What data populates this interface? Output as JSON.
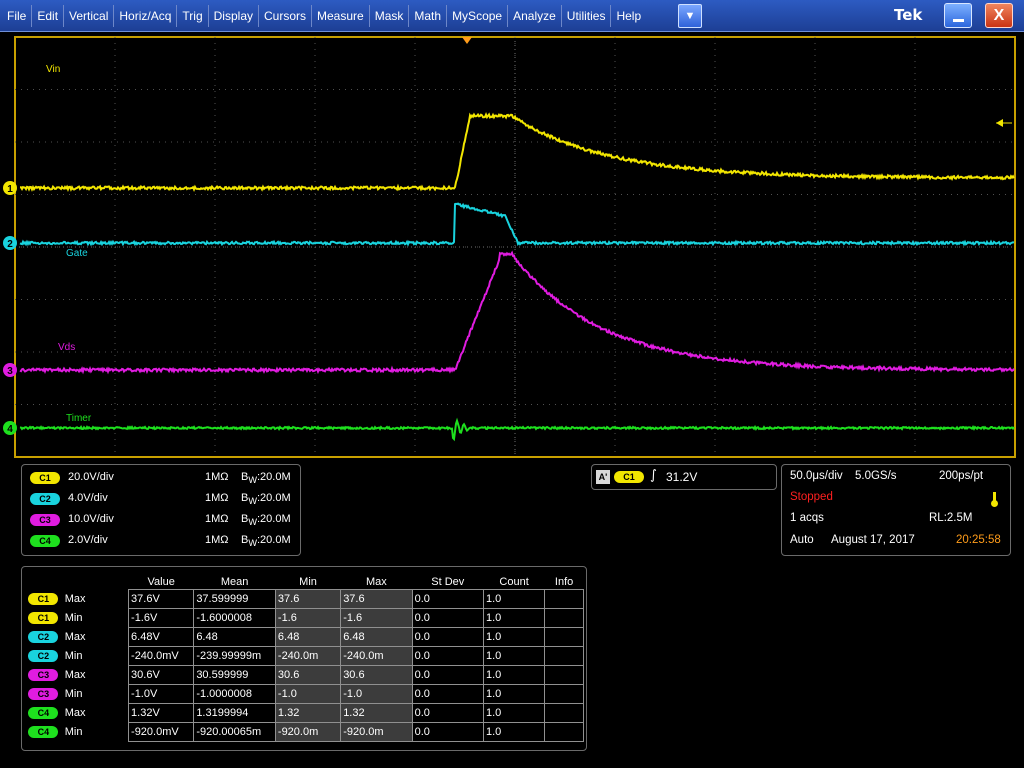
{
  "menubar": {
    "items": [
      "File",
      "Edit",
      "Vertical",
      "Horiz/Acq",
      "Trig",
      "Display",
      "Cursors",
      "Measure",
      "Mask",
      "Math",
      "MyScope",
      "Analyze",
      "Utilities",
      "Help"
    ],
    "dropdown_glyph": "▼",
    "brand": "Tek",
    "minimize_icon": "minimize-icon",
    "close_glyph": "X"
  },
  "channels": [
    {
      "num": "1",
      "label": "Vin",
      "color": "#f2e600"
    },
    {
      "num": "2",
      "label": "Gate",
      "color": "#19d3de"
    },
    {
      "num": "3",
      "label": "Vds",
      "color": "#e01ce0"
    },
    {
      "num": "4",
      "label": "Timer",
      "color": "#1ee01e"
    }
  ],
  "vertical": [
    {
      "ch": "C1",
      "scale": "20.0V/div",
      "impedance": "1MΩ",
      "bw_prefix": "B",
      "bw_sub": "W",
      "bw_value": ":20.0M",
      "color": "#f2e600"
    },
    {
      "ch": "C2",
      "scale": "4.0V/div",
      "impedance": "1MΩ",
      "bw_prefix": "B",
      "bw_sub": "W",
      "bw_value": ":20.0M",
      "color": "#19d3de"
    },
    {
      "ch": "C3",
      "scale": "10.0V/div",
      "impedance": "1MΩ",
      "bw_prefix": "B",
      "bw_sub": "W",
      "bw_value": ":20.0M",
      "color": "#e01ce0"
    },
    {
      "ch": "C4",
      "scale": "2.0V/div",
      "impedance": "1MΩ",
      "bw_prefix": "B",
      "bw_sub": "W",
      "bw_value": ":20.0M",
      "color": "#1ee01e"
    }
  ],
  "trigger": {
    "mode": "A'",
    "source": "C1",
    "slope_glyph": "∫",
    "level": "31.2V"
  },
  "horizontal": {
    "timebase": "50.0μs/div",
    "sample_rate": "5.0GS/s",
    "resolution": "200ps/pt",
    "state": "Stopped",
    "acqs": "1 acqs",
    "record_length": "RL:2.5M",
    "trigger_mode": "Auto",
    "date": "August 17, 2017",
    "time": "20:25:58"
  },
  "measurements": {
    "headers": [
      "Value",
      "Mean",
      "Min",
      "Max",
      "St Dev",
      "Count",
      "Info"
    ],
    "rows": [
      {
        "ch": "C1",
        "meas": "Max",
        "color": "#f2e600",
        "cells": [
          "37.6V",
          "37.599999",
          "37.6",
          "37.6",
          "0.0",
          "1.0",
          ""
        ]
      },
      {
        "ch": "C1",
        "meas": "Min",
        "color": "#f2e600",
        "cells": [
          "-1.6V",
          "-1.6000008",
          "-1.6",
          "-1.6",
          "0.0",
          "1.0",
          ""
        ]
      },
      {
        "ch": "C2",
        "meas": "Max",
        "color": "#19d3de",
        "cells": [
          "6.48V",
          "6.48",
          "6.48",
          "6.48",
          "0.0",
          "1.0",
          ""
        ]
      },
      {
        "ch": "C2",
        "meas": "Min",
        "color": "#19d3de",
        "cells": [
          "-240.0mV",
          "-239.99999m",
          "-240.0m",
          "-240.0m",
          "0.0",
          "1.0",
          ""
        ]
      },
      {
        "ch": "C3",
        "meas": "Max",
        "color": "#e01ce0",
        "cells": [
          "30.6V",
          "30.599999",
          "30.6",
          "30.6",
          "0.0",
          "1.0",
          ""
        ]
      },
      {
        "ch": "C3",
        "meas": "Min",
        "color": "#e01ce0",
        "cells": [
          "-1.0V",
          "-1.0000008",
          "-1.0",
          "-1.0",
          "0.0",
          "1.0",
          ""
        ]
      },
      {
        "ch": "C4",
        "meas": "Max",
        "color": "#1ee01e",
        "cells": [
          "1.32V",
          "1.3199994",
          "1.32",
          "1.32",
          "0.0",
          "1.0",
          ""
        ]
      },
      {
        "ch": "C4",
        "meas": "Min",
        "color": "#1ee01e",
        "cells": [
          "-920.0mV",
          "-920.00065m",
          "-920.0m",
          "-920.0m",
          "0.0",
          "1.0",
          ""
        ]
      }
    ]
  }
}
